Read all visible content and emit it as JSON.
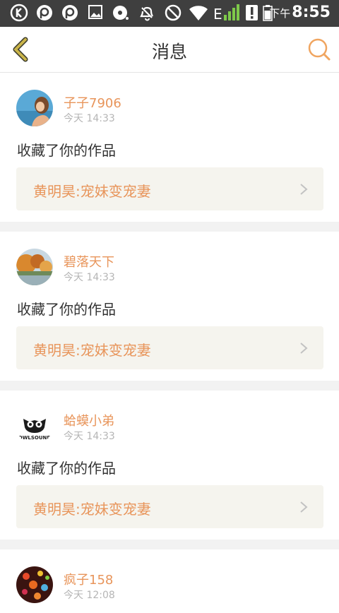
{
  "status_bar": {
    "time_prefix": "下午",
    "time": "8:55",
    "network_label": "E",
    "icons": [
      "k-app-icon",
      "p-app-icon",
      "p-app-icon",
      "image-icon",
      "disc-icon",
      "bell-icon",
      "block-icon",
      "wifi-icon",
      "signal-icon",
      "alert-icon",
      "battery-icon"
    ]
  },
  "header": {
    "title": "消息",
    "back_icon": "chevron-left-icon",
    "search_icon": "search-icon"
  },
  "colors": {
    "accent": "#e8955b",
    "back_arrow": "#c9b44a",
    "text": "#333333",
    "muted": "#b5b5b5",
    "card_link_bg": "#f5f4ee"
  },
  "notifications": [
    {
      "user": "子子7906",
      "time": "今天 14:33",
      "action": "收藏了你的作品",
      "work_title": "黄明昊:宠妹变宠妻"
    },
    {
      "user": "碧落天下",
      "time": "今天 14:33",
      "action": "收藏了你的作品",
      "work_title": "黄明昊:宠妹变宠妻"
    },
    {
      "user": "蛤蟆小弟",
      "time": "今天 14:33",
      "action": "收藏了你的作品",
      "work_title": "黄明昊:宠妹变宠妻",
      "avatar_text": "OWLSOUND"
    },
    {
      "user": "疯子158",
      "time": "今天 12:08"
    }
  ]
}
